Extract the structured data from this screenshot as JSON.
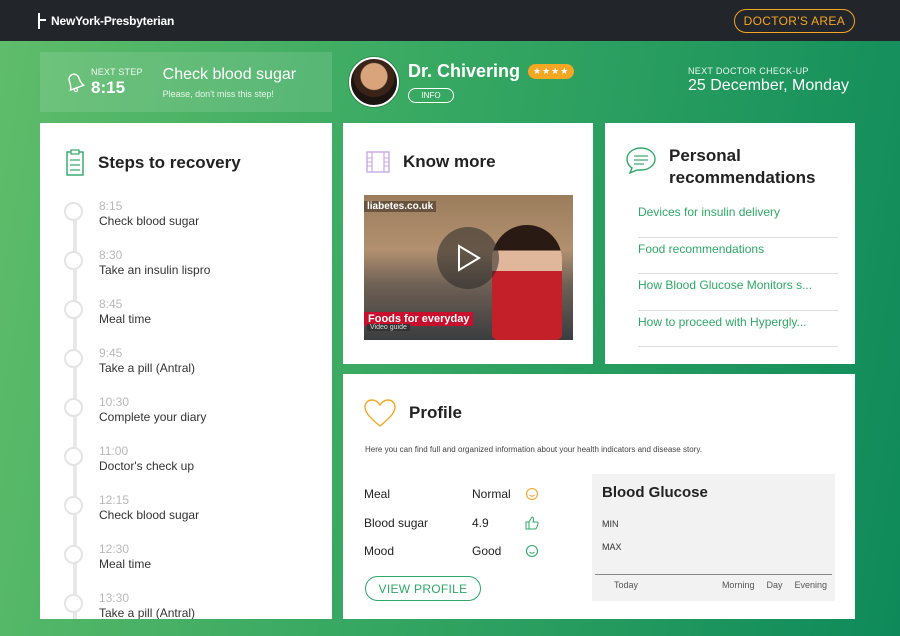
{
  "header": {
    "logo_text": "NewYork-Presbyterian",
    "doctor_area_label": "DOCTOR'S AREA"
  },
  "next_step": {
    "label": "NEXT STEP",
    "time": "8:15",
    "title": "Check blood sugar",
    "subtitle": "Please, don't miss this step!"
  },
  "doctor": {
    "name": "Dr. Chivering",
    "rating_display": "★★★★",
    "rating": 4,
    "info_label": "INFO"
  },
  "checkup": {
    "label": "NEXT DOCTOR CHECK-UP",
    "date": "25 December, Monday"
  },
  "recovery": {
    "title": "Steps to recovery",
    "steps": [
      {
        "time": "8:15",
        "label": "Check blood sugar"
      },
      {
        "time": "8:30",
        "label": "Take an insulin lispro"
      },
      {
        "time": "8:45",
        "label": "Meal time"
      },
      {
        "time": "9:45",
        "label": "Take a pill (Antral)"
      },
      {
        "time": "10:30",
        "label": "Complete your diary"
      },
      {
        "time": "11:00",
        "label": "Doctor's check up"
      },
      {
        "time": "12:15",
        "label": "Check blood sugar"
      },
      {
        "time": "12:30",
        "label": "Meal time"
      },
      {
        "time": "13:30",
        "label": "Take a pill (Antral)"
      }
    ]
  },
  "know_more": {
    "title": "Know more",
    "video": {
      "url_text": "liabetes.co.uk",
      "caption": "Foods for everyday",
      "sub_caption": "Video guide"
    }
  },
  "recommendations": {
    "title_line1": "Personal",
    "title_line2": "recommendations",
    "items": [
      "Devices for insulin delivery",
      "Food recommendations",
      "How Blood Glucose Monitors s...",
      "How to proceed with Hypergly..."
    ]
  },
  "profile": {
    "title": "Profile",
    "description": "Here you can find full and organized information about your health indicators and disease story.",
    "metrics": [
      {
        "label": "Meal",
        "value": "Normal",
        "icon": "smiley-icon"
      },
      {
        "label": "Blood sugar",
        "value": "4.9",
        "icon": "thumbs-up-icon"
      },
      {
        "label": "Mood",
        "value": "Good",
        "icon": "smiley-icon"
      }
    ],
    "view_button": "VIEW PROFILE"
  },
  "blood_glucose": {
    "title": "Blood Glucose",
    "min_label": "MIN",
    "max_label": "MAX",
    "axis_labels": [
      "Today",
      "Morning",
      "Day",
      "Evening"
    ]
  },
  "colors": {
    "accent_green": "#2ea866",
    "accent_orange": "#f5a623",
    "topbar": "#22262b"
  }
}
